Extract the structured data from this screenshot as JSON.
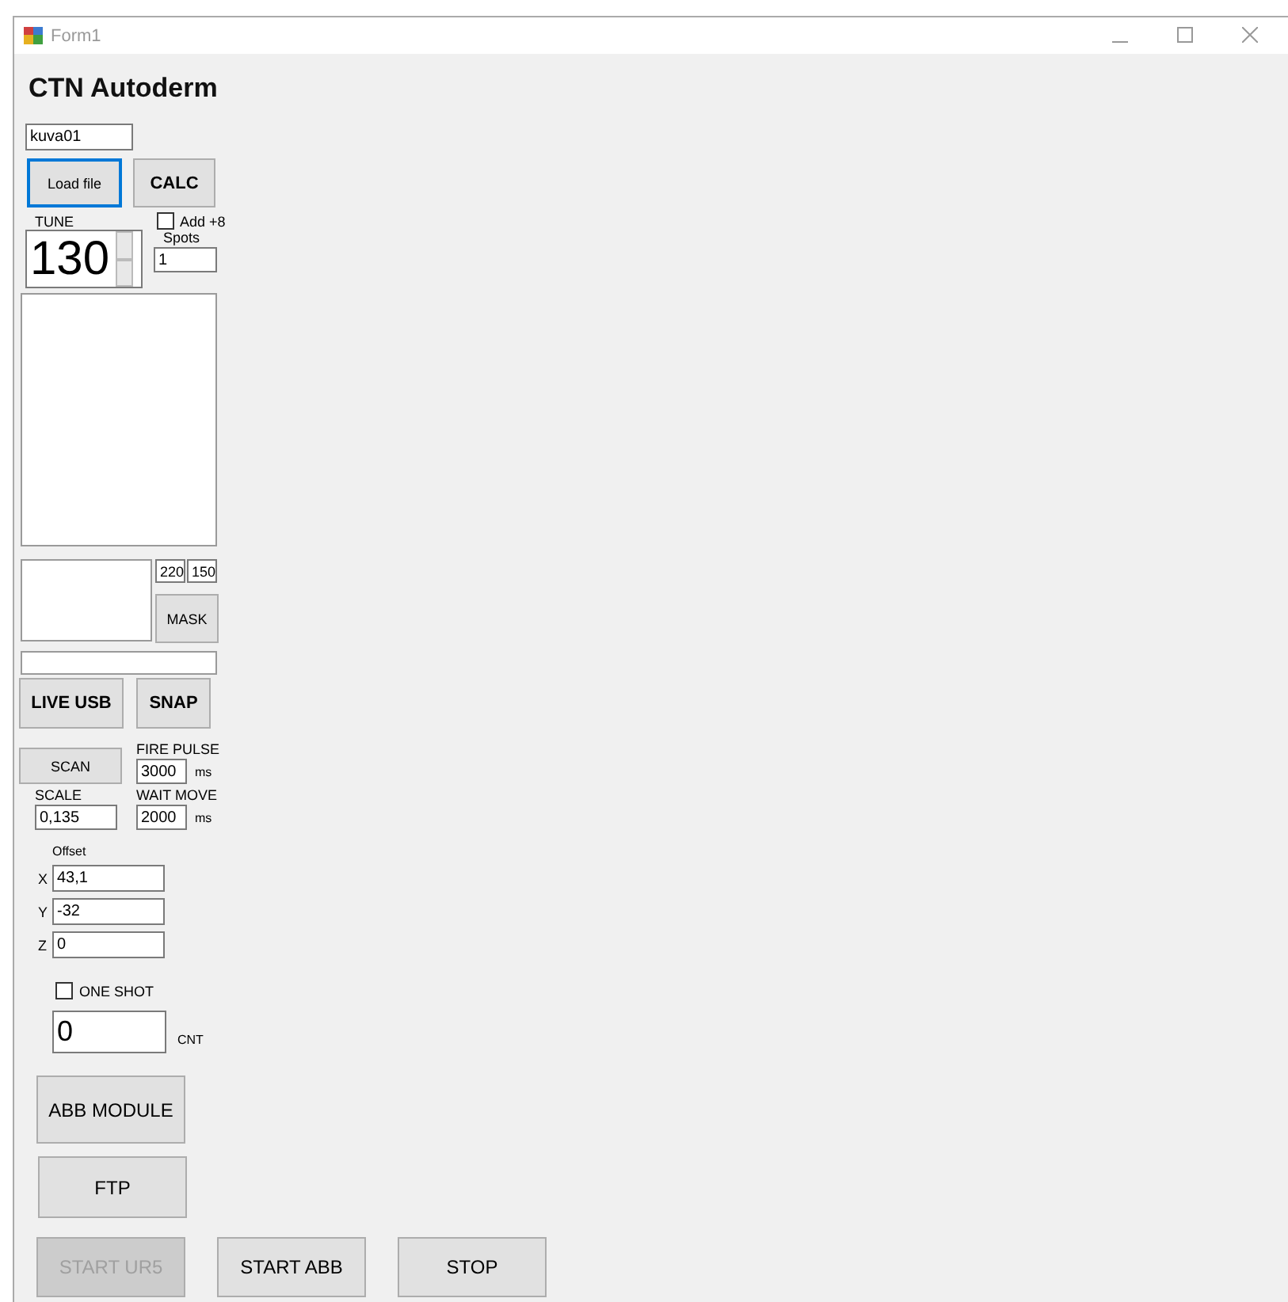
{
  "window": {
    "title": "Form1"
  },
  "heading": "CTN Autoderm",
  "file_field": {
    "value": "kuva01"
  },
  "load_button": {
    "label": "Load file",
    "focused": true,
    "disabled": false
  },
  "calc_button": {
    "label": "CALC",
    "focused": false,
    "disabled": false
  },
  "tune": {
    "label": "TUNE",
    "value": "130"
  },
  "add8": {
    "label": "Add +8",
    "checked": false
  },
  "spots": {
    "label": "Spots",
    "value": "1"
  },
  "mask_fields": [
    "220",
    "150"
  ],
  "mask_button": {
    "label": "MASK",
    "focused": false,
    "disabled": false
  },
  "live_usb_button": {
    "label": "LIVE USB",
    "focused": false,
    "disabled": false
  },
  "snap_button": {
    "label": "SNAP",
    "focused": false,
    "disabled": false
  },
  "scan_button": {
    "label": "SCAN",
    "focused": false,
    "disabled": false
  },
  "fire_pulse": {
    "label": "FIRE PULSE",
    "value": "3000",
    "unit": "ms"
  },
  "scale": {
    "label": "SCALE",
    "value": "0,135"
  },
  "wait_move": {
    "label": "WAIT MOVE",
    "value": "2000",
    "unit": "ms"
  },
  "offset": {
    "label": "Offset",
    "axes": [
      {
        "label": "X",
        "value": "43,1"
      },
      {
        "label": "Y",
        "value": "-32"
      },
      {
        "label": "Z",
        "value": "0"
      }
    ]
  },
  "one_shot": {
    "label": "ONE SHOT",
    "checked": false
  },
  "counter": {
    "value": "0",
    "label": "CNT"
  },
  "abb_module_button": {
    "label": "ABB MODULE",
    "focused": false,
    "disabled": false
  },
  "ftp_button": {
    "label": "FTP",
    "focused": false,
    "disabled": false
  },
  "bottom_buttons": [
    {
      "label": "START UR5",
      "focused": false,
      "disabled": true
    },
    {
      "label": "START ABB",
      "focused": false,
      "disabled": false
    },
    {
      "label": "STOP",
      "focused": false,
      "disabled": false
    }
  ]
}
